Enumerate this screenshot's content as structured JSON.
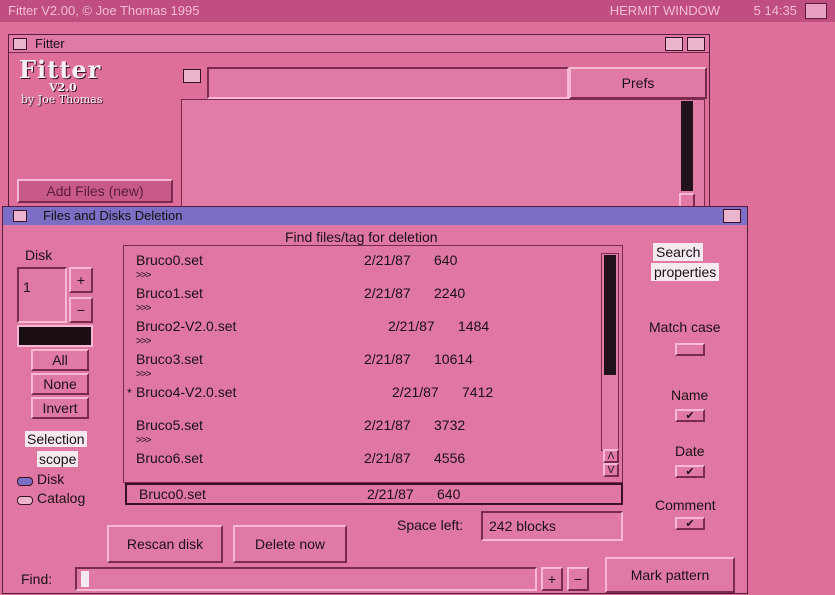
{
  "screen": {
    "title": "Fitter V2.00, © Joe Thomas 1995",
    "right_text": "HERMIT WINDOW",
    "clock": "5 14:35"
  },
  "fitter": {
    "title": "Fitter",
    "logo_title": "Fitter",
    "logo_version": "V2.0",
    "logo_author": "by Joe Thomas",
    "prefs_label": "Prefs",
    "add_files_label": "Add Files (new)",
    "path_value": ""
  },
  "deletion": {
    "title": "Files and Disks Deletion",
    "list_header": "Find files/tag for deletion",
    "disk_label": "Disk",
    "disk_value": "1",
    "plus": "+",
    "minus": "−",
    "all_label": "All",
    "none_label": "None",
    "invert_label": "Invert",
    "selection_scope_line1": "Selection",
    "selection_scope_line2": "scope",
    "scope_options": [
      "Disk",
      "Catalog"
    ],
    "scope_selected": "Disk",
    "files": [
      {
        "name": "Bruco0.set",
        "date": "2/21/87",
        "size": "640",
        "marked": false,
        "arrow": ">>>"
      },
      {
        "name": "Bruco1.set",
        "date": "2/21/87",
        "size": "2240",
        "marked": false,
        "arrow": ">>>"
      },
      {
        "name": "Bruco2-V2.0.set",
        "date": "2/21/87",
        "size": "1484",
        "marked": false,
        "arrow": ">>>"
      },
      {
        "name": "Bruco3.set",
        "date": "2/21/87",
        "size": "10614",
        "marked": false,
        "arrow": ">>>"
      },
      {
        "name": "Bruco4-V2.0.set",
        "date": "2/21/87",
        "size": "7412",
        "marked": true,
        "arrow": ""
      },
      {
        "name": "Bruco5.set",
        "date": "2/21/87",
        "size": "3732",
        "marked": false,
        "arrow": ">>>"
      },
      {
        "name": "Bruco6.set",
        "date": "2/21/87",
        "size": "4556",
        "marked": false,
        "arrow": ""
      }
    ],
    "mark_symbol": "*",
    "selected_file": {
      "name": "Bruco0.set",
      "date": "2/21/87",
      "size": "640"
    },
    "search_properties_line1": "Search",
    "search_properties_line2": "properties",
    "match_case_label": "Match case",
    "name_label": "Name",
    "date_label": "Date",
    "comment_label": "Comment",
    "check_mark": "✔",
    "space_left_label": "Space left:",
    "space_left_value": "242 blocks",
    "rescan_label": "Rescan disk",
    "delete_label": "Delete now",
    "find_label": "Find:",
    "find_value": "",
    "mark_pattern_label": "Mark pattern"
  }
}
